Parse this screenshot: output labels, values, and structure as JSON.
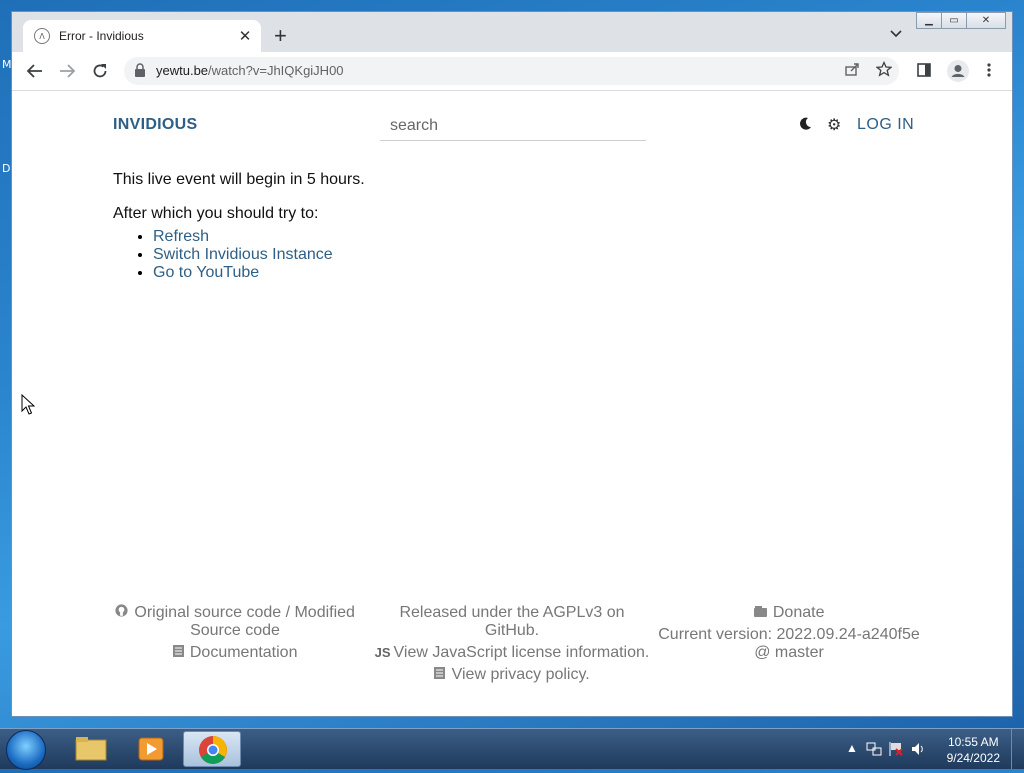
{
  "desktop": {
    "left_labels": [
      "M",
      "D"
    ]
  },
  "browser": {
    "tab_title": "Error - Invidious",
    "tab_close_glyph": "✕",
    "new_tab_glyph": "+",
    "tab_menu_glyph": "⌄",
    "url_host": "yewtu.be",
    "url_path": "/watch?v=JhIQKgiJH00",
    "window_buttons": {
      "minimize": "▁",
      "maximize": "▭",
      "close": "✕"
    }
  },
  "page": {
    "brand": "INVIDIOUS",
    "search_placeholder": "search",
    "login": "LOG IN",
    "message_1": "This live event will begin in 5 hours.",
    "message_2": "After which you should try to:",
    "options": [
      "Refresh",
      "Switch Invidious Instance",
      "Go to YouTube"
    ],
    "footer": {
      "col1": {
        "source": "Original source code / Modified",
        "source_2": "Source code",
        "docs": "Documentation"
      },
      "col2": {
        "license": "Released under the AGPLv3 on",
        "license_2": "GitHub.",
        "js_badge": "JS",
        "js_license": "View JavaScript license information.",
        "privacy": "View privacy policy."
      },
      "col3": {
        "donate": "Donate",
        "version": "Current version: 2022.09.24-a240f5e",
        "branch": "@ master"
      }
    }
  },
  "taskbar": {
    "time": "10:55 AM",
    "date": "9/24/2022"
  },
  "icons": {
    "back": "back-arrow-icon",
    "forward": "forward-arrow-icon",
    "reload": "reload-icon",
    "lock": "lock-icon",
    "share": "share-icon",
    "star": "bookmark-star-icon",
    "sidepanel": "side-panel-icon",
    "profile": "profile-icon",
    "menu": "kebab-menu-icon",
    "theme": "moon-icon",
    "settings": "gear-icon",
    "github": "github-icon",
    "docs": "document-icon",
    "donate": "wallet-icon",
    "privacy": "document-icon"
  },
  "colors": {
    "brand": "#2e5f86",
    "link": "#2e5f86",
    "footer_text": "#777777",
    "tab_strip": "#dee1e6"
  }
}
